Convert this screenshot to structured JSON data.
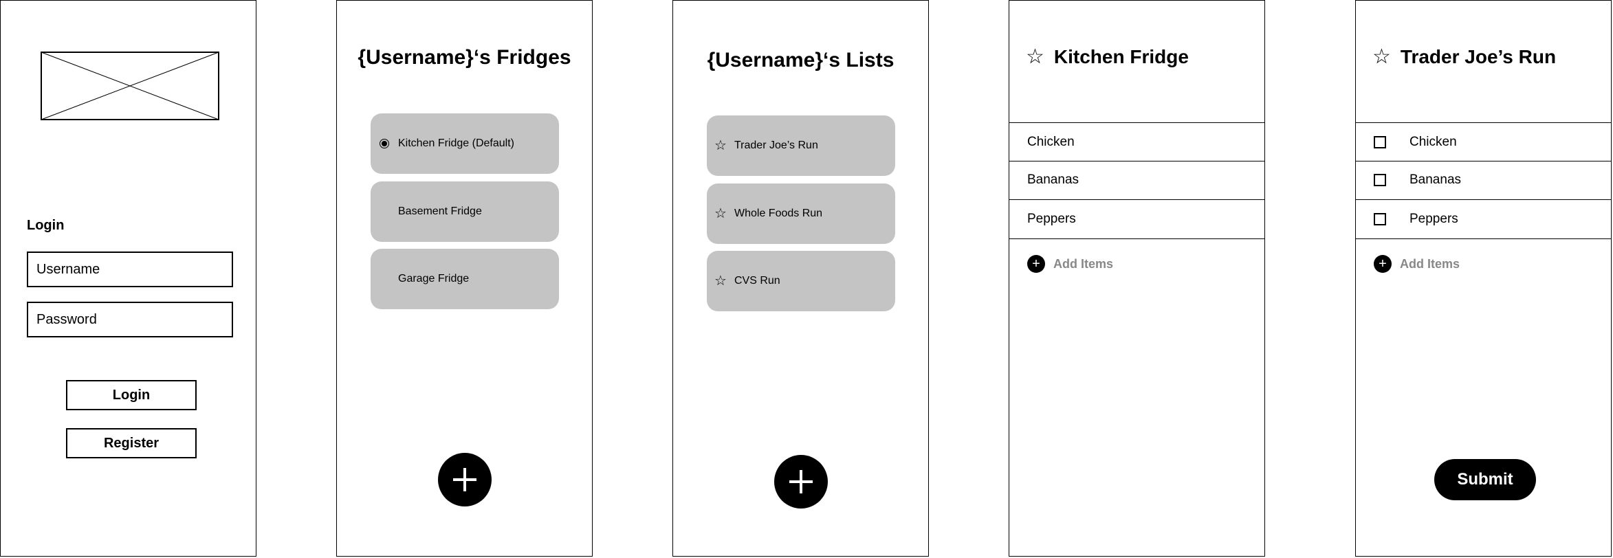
{
  "login_screen": {
    "heading": "Login",
    "username_placeholder": "Username",
    "password_placeholder": "Password",
    "login_button": "Login",
    "register_button": "Register"
  },
  "fridges_screen": {
    "title": "{Username}‘s Fridges",
    "items": [
      {
        "label": "Kitchen Fridge (Default)",
        "selected": true
      },
      {
        "label": "Basement Fridge",
        "selected": false
      },
      {
        "label": "Garage Fridge",
        "selected": false
      }
    ],
    "add_icon": "plus-icon"
  },
  "lists_screen": {
    "title": "{Username}‘s Lists",
    "items": [
      {
        "label": "Trader Joe’s Run",
        "icon": "star-outline-icon"
      },
      {
        "label": "Whole Foods Run",
        "icon": "star-outline-icon"
      },
      {
        "label": "CVS Run",
        "icon": "star-outline-icon"
      }
    ],
    "add_icon": "plus-icon"
  },
  "fridge_detail": {
    "title": "Kitchen Fridge",
    "items": [
      "Chicken",
      "Bananas",
      "Peppers"
    ],
    "add_label": "Add Items"
  },
  "list_detail": {
    "title": "Trader Joe’s Run",
    "items": [
      "Chicken",
      "Bananas",
      "Peppers"
    ],
    "add_label": "Add Items",
    "submit_label": "Submit"
  },
  "colors": {
    "card_background": "#c4c4c4",
    "add_items_text": "#888888",
    "accent": "#000000"
  }
}
